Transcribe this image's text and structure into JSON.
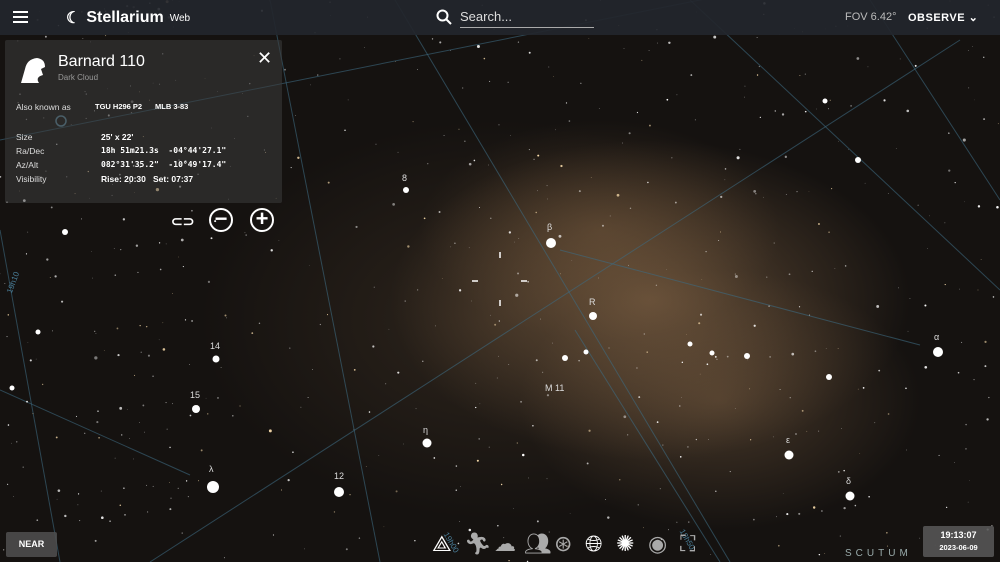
{
  "header": {
    "app_name": "Stellarium",
    "app_suffix": "Web",
    "search_placeholder": "Search...",
    "fov": "FOV 6.42°",
    "observe_label": "OBSERVE"
  },
  "info_panel": {
    "title": "Barnard 110",
    "type": "Dark Cloud",
    "aka_label": "Also known as",
    "aka": [
      "TGU H296 P2",
      "MLB 3-83"
    ],
    "rows": [
      {
        "label": "Size",
        "value": "25' x 22'"
      },
      {
        "label": "Ra/Dec",
        "value": "18h 51m21.3s  -04°44'27.1\""
      },
      {
        "label": "Az/Alt",
        "value": "082°31'35.2\"  -10°49'17.4\""
      },
      {
        "label": "Visibility",
        "value": "Rise: 20:30   Set: 07:37"
      }
    ]
  },
  "sky_labels": [
    "8",
    "β",
    "R",
    "α",
    "M 11",
    "ε",
    "δ",
    "η",
    "14",
    "15",
    "λ",
    "12"
  ],
  "grid_labels": [
    "19h00",
    "18h50",
    "19h10"
  ],
  "constellation": "SCUTUM",
  "bottom": {
    "near_label": "NEAR",
    "time": "19:13:07",
    "date": "2023-06-09"
  },
  "colors": {
    "topbar": "#23262d",
    "grid": "#4a7f9a"
  }
}
